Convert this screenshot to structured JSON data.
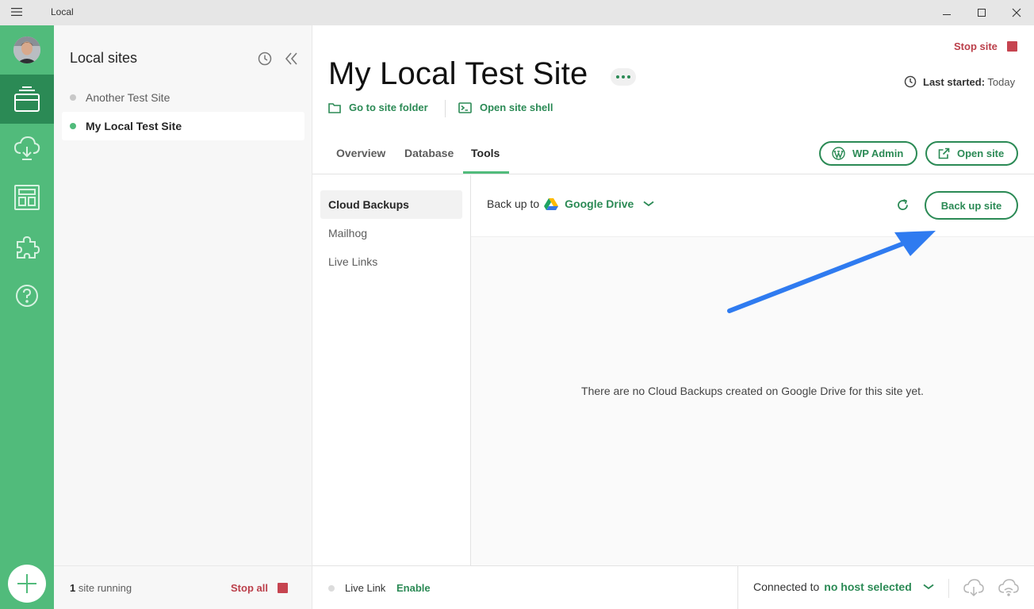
{
  "window": {
    "title": "Local"
  },
  "colors": {
    "brand_green": "#51bb7b",
    "dark_green": "#2b8a55",
    "stop_red": "#bb3f4a",
    "arrow_blue": "#2f7bf0"
  },
  "rail": {
    "icons": [
      "avatar",
      "sites-icon",
      "cloud-backup-icon",
      "blueprints-icon",
      "addons-icon",
      "help-icon",
      "add-site-icon"
    ]
  },
  "sites_panel": {
    "title": "Local sites",
    "sites": [
      {
        "name": "Another Test Site",
        "running": false,
        "active": false
      },
      {
        "name": "My Local Test Site",
        "running": true,
        "active": true
      }
    ],
    "footer": {
      "count": "1",
      "running_text": "site running",
      "stop_all": "Stop all"
    }
  },
  "main": {
    "stop_site": "Stop site",
    "site_title": "My Local Test Site",
    "last_started_label": "Last started:",
    "last_started_value": "Today",
    "go_to_folder": "Go to site folder",
    "open_shell": "Open site shell",
    "tabs": [
      {
        "label": "Overview",
        "active": false
      },
      {
        "label": "Database",
        "active": false
      },
      {
        "label": "Tools",
        "active": true
      }
    ],
    "wp_admin": "WP Admin",
    "open_site": "Open site",
    "tools_nav": [
      {
        "label": "Cloud Backups",
        "active": true
      },
      {
        "label": "Mailhog",
        "active": false
      },
      {
        "label": "Live Links",
        "active": false
      }
    ],
    "backup": {
      "back_up_to": "Back up to",
      "provider": "Google Drive",
      "button": "Back up site",
      "empty": "There are no Cloud Backups created on Google Drive for this site yet."
    },
    "footer": {
      "live_link": "Live Link",
      "enable": "Enable",
      "connected_to": "Connected to",
      "host": "no host selected"
    }
  }
}
